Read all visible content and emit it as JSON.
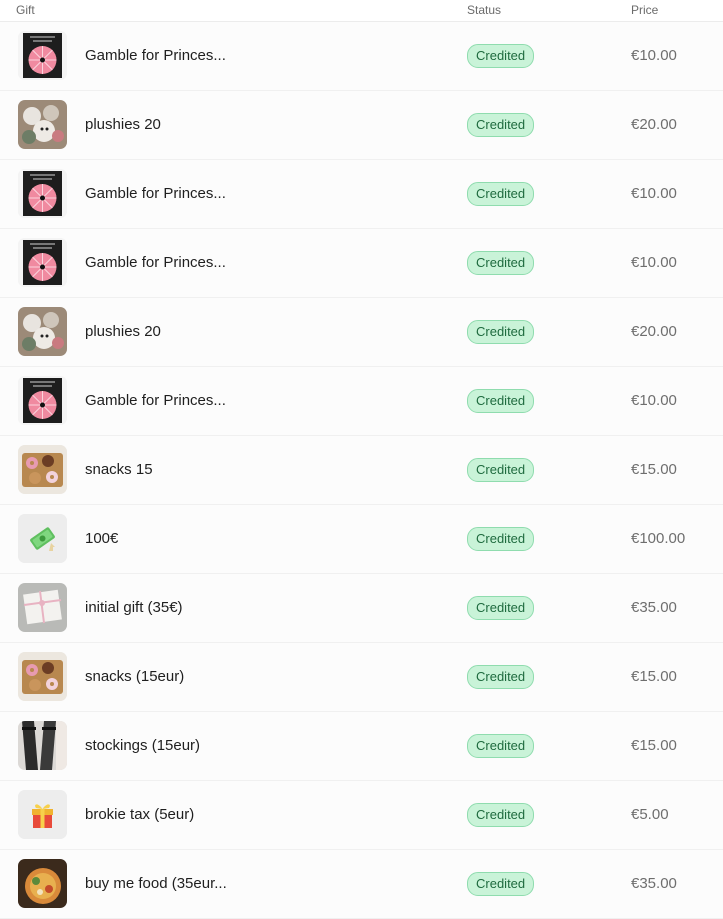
{
  "table": {
    "headers": {
      "gift": "Gift",
      "status": "Status",
      "price": "Price"
    },
    "rows": [
      {
        "thumb": "wheel-image",
        "name": "Gamble for Princes...",
        "status": "Credited",
        "price": "€10.00"
      },
      {
        "thumb": "plushies-image",
        "name": "plushies 20",
        "status": "Credited",
        "price": "€20.00"
      },
      {
        "thumb": "wheel-image",
        "name": "Gamble for Princes...",
        "status": "Credited",
        "price": "€10.00"
      },
      {
        "thumb": "wheel-image",
        "name": "Gamble for Princes...",
        "status": "Credited",
        "price": "€10.00"
      },
      {
        "thumb": "plushies-image",
        "name": "plushies 20",
        "status": "Credited",
        "price": "€20.00"
      },
      {
        "thumb": "wheel-image",
        "name": "Gamble for Princes...",
        "status": "Credited",
        "price": "€10.00"
      },
      {
        "thumb": "snacks-image",
        "name": "snacks 15",
        "status": "Credited",
        "price": "€15.00"
      },
      {
        "thumb": "money-icon",
        "name": "100€",
        "status": "Credited",
        "price": "€100.00"
      },
      {
        "thumb": "gift-box-image",
        "name": "initial gift (35€)",
        "status": "Credited",
        "price": "€35.00"
      },
      {
        "thumb": "snacks-image",
        "name": "snacks (15eur)",
        "status": "Credited",
        "price": "€15.00"
      },
      {
        "thumb": "stockings-image",
        "name": "stockings (15eur)",
        "status": "Credited",
        "price": "€15.00"
      },
      {
        "thumb": "gift-icon",
        "name": "brokie tax (5eur)",
        "status": "Credited",
        "price": "€5.00"
      },
      {
        "thumb": "food-image",
        "name": "buy me food (35eur...",
        "status": "Credited",
        "price": "€35.00"
      }
    ]
  },
  "colors": {
    "badge_bg": "#c9f3d8",
    "badge_border": "#8fdcae",
    "badge_text": "#1f6b3f",
    "price_text": "#6e6e6e"
  }
}
